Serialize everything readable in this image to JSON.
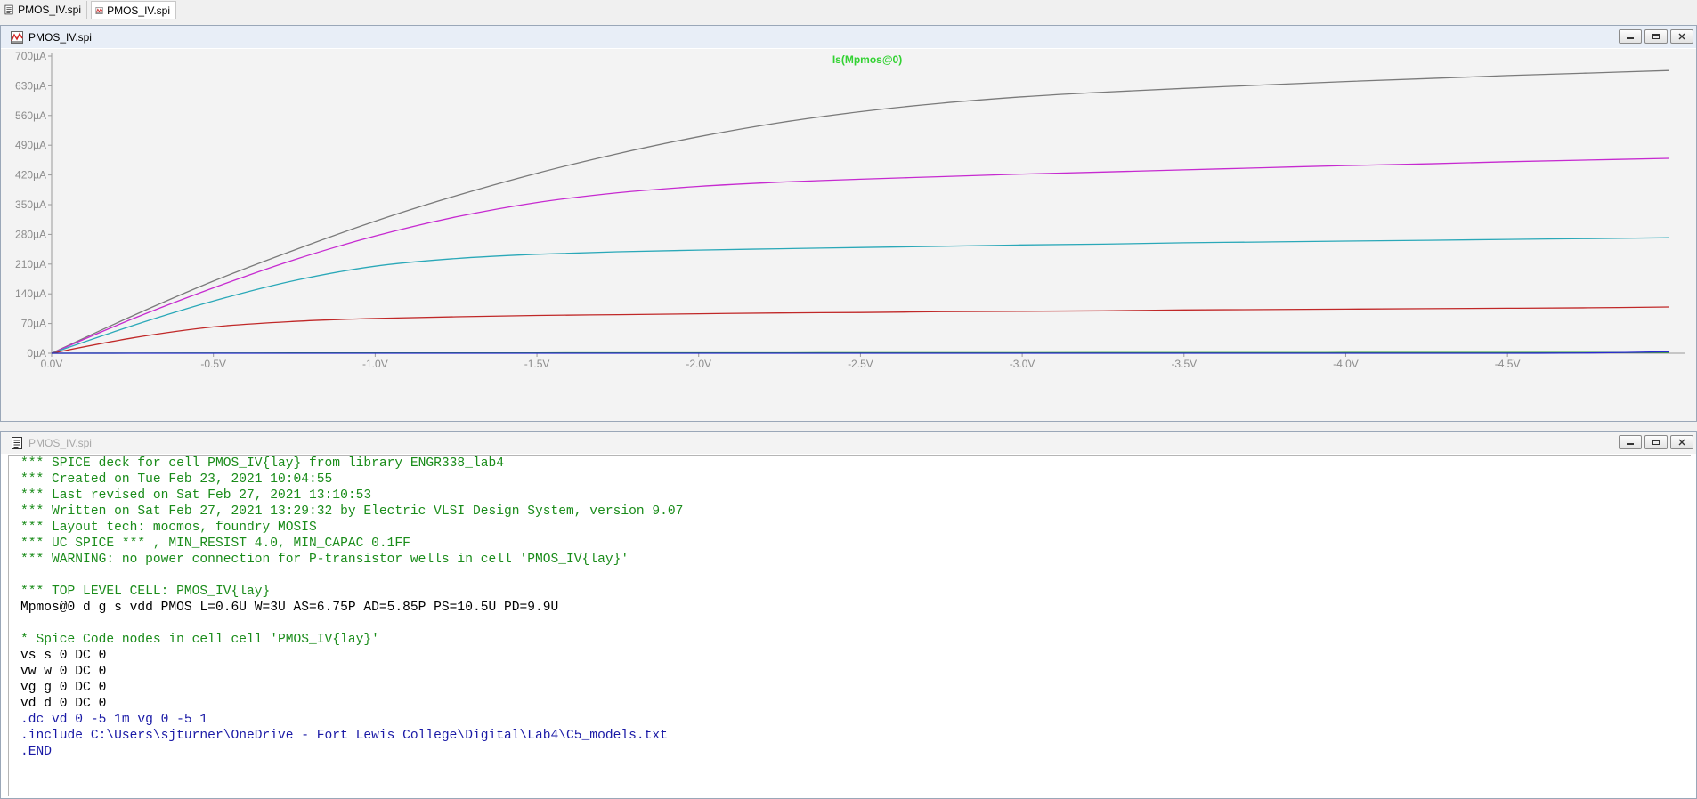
{
  "tabs": [
    {
      "label": "PMOS_IV.spi",
      "icon": "document-icon"
    },
    {
      "label": "PMOS_IV.spi",
      "icon": "waveform-icon"
    }
  ],
  "waveform_window": {
    "title": "PMOS_IV.spi",
    "icon": "waveform-icon",
    "buttons": {
      "minimize": "minimize",
      "restore": "restore",
      "close": "close"
    }
  },
  "netlist_window": {
    "title": "PMOS_IV.spi",
    "icon": "document-icon",
    "buttons": {
      "minimize": "minimize",
      "restore": "restore",
      "close": "close"
    },
    "lines": [
      {
        "text": "*** SPICE deck for cell PMOS_IV{lay} from library ENGR338_lab4",
        "kind": "comment"
      },
      {
        "text": "*** Created on Tue Feb 23, 2021 10:04:55",
        "kind": "comment"
      },
      {
        "text": "*** Last revised on Sat Feb 27, 2021 13:10:53",
        "kind": "comment"
      },
      {
        "text": "*** Written on Sat Feb 27, 2021 13:29:32 by Electric VLSI Design System, version 9.07",
        "kind": "comment"
      },
      {
        "text": "*** Layout tech: mocmos, foundry MOSIS",
        "kind": "comment"
      },
      {
        "text": "*** UC SPICE *** , MIN_RESIST 4.0, MIN_CAPAC 0.1FF",
        "kind": "comment"
      },
      {
        "text": "*** WARNING: no power connection for P-transistor wells in cell 'PMOS_IV{lay}'",
        "kind": "comment"
      },
      {
        "text": "",
        "kind": "black"
      },
      {
        "text": "*** TOP LEVEL CELL: PMOS_IV{lay}",
        "kind": "comment"
      },
      {
        "text": "Mpmos@0 d g s vdd PMOS L=0.6U W=3U AS=6.75P AD=5.85P PS=10.5U PD=9.9U",
        "kind": "black"
      },
      {
        "text": "",
        "kind": "black"
      },
      {
        "text": "* Spice Code nodes in cell cell 'PMOS_IV{lay}'",
        "kind": "comment"
      },
      {
        "text": "vs s 0 DC 0",
        "kind": "black"
      },
      {
        "text": "vw w 0 DC 0",
        "kind": "black"
      },
      {
        "text": "vg g 0 DC 0",
        "kind": "black"
      },
      {
        "text": "vd d 0 DC 0",
        "kind": "black"
      },
      {
        "text": ".dc vd 0 -5 1m vg 0 -5 1",
        "kind": "blue"
      },
      {
        "text": ".include C:\\Users\\sjturner\\OneDrive - Fort Lewis College\\Digital\\Lab4\\C5_models.txt",
        "kind": "blue"
      },
      {
        "text": ".END",
        "kind": "blue"
      }
    ]
  },
  "colors": {
    "background": "#f3f3f3",
    "axis": "#9a9a9a",
    "tick_text": "#8c8c8c",
    "signal_title": "#32d232",
    "comment_text": "#1a8c1a",
    "directive_text": "#1a1aa6"
  },
  "chart_data": {
    "type": "line",
    "title": "Is(Mpmos@0)",
    "xlabel": "",
    "ylabel": "",
    "x_ticks": [
      "0.0V",
      "-0.5V",
      "-1.0V",
      "-1.5V",
      "-2.0V",
      "-2.5V",
      "-3.0V",
      "-3.5V",
      "-4.0V",
      "-4.5V"
    ],
    "y_ticks": [
      "0µA",
      "70µA",
      "140µA",
      "210µA",
      "280µA",
      "350µA",
      "420µA",
      "490µA",
      "560µA",
      "630µA",
      "700µA"
    ],
    "xlim": [
      0,
      -5.05
    ],
    "ylim": [
      0,
      700
    ],
    "grid": false,
    "legend": "none",
    "x": [
      0,
      -0.25,
      -0.5,
      -0.75,
      -1.0,
      -1.25,
      -1.5,
      -1.75,
      -2.0,
      -2.25,
      -2.5,
      -2.75,
      -3.0,
      -3.25,
      -3.5,
      -3.75,
      -4.0,
      -4.25,
      -4.5,
      -4.75,
      -5.0
    ],
    "series": [
      {
        "color": "#7a7a7a",
        "values": [
          0,
          88,
          170,
          243,
          311,
          371,
          424,
          470,
          510,
          543,
          569,
          589,
          604,
          615,
          624,
          632,
          640,
          647,
          654,
          660,
          666
        ]
      },
      {
        "color": "#c62ad0",
        "values": [
          0,
          81,
          154,
          220,
          276,
          321,
          355,
          378,
          393,
          403,
          410,
          416,
          422,
          427,
          432,
          437,
          442,
          446,
          451,
          455,
          459
        ]
      },
      {
        "color": "#2aa8b8",
        "values": [
          0,
          65,
          123,
          171,
          205,
          223,
          233,
          239,
          243,
          246,
          249,
          252,
          255,
          257,
          260,
          262,
          264,
          266,
          268,
          270,
          272
        ]
      },
      {
        "color": "#c02828",
        "values": [
          0,
          36,
          62,
          75,
          82,
          86,
          89,
          91,
          93,
          95,
          96,
          98,
          99,
          100,
          102,
          103,
          104,
          105,
          106,
          107,
          109
        ]
      },
      {
        "color": "#2a9a2a",
        "values": [
          0,
          0.3,
          0.5,
          0.6,
          0.7,
          0.8,
          0.9,
          1.0,
          1.0,
          1.1,
          1.2,
          1.3,
          1.3,
          1.4,
          1.5,
          1.5,
          1.6,
          1.6,
          1.7,
          1.7,
          1.8
        ]
      },
      {
        "color": "#2a2ad0",
        "values": [
          0,
          0,
          0,
          0,
          0,
          0,
          0,
          0,
          0,
          0,
          0,
          0,
          0,
          0,
          0,
          0,
          0,
          0,
          0.1,
          0.6,
          3.5
        ]
      }
    ]
  }
}
